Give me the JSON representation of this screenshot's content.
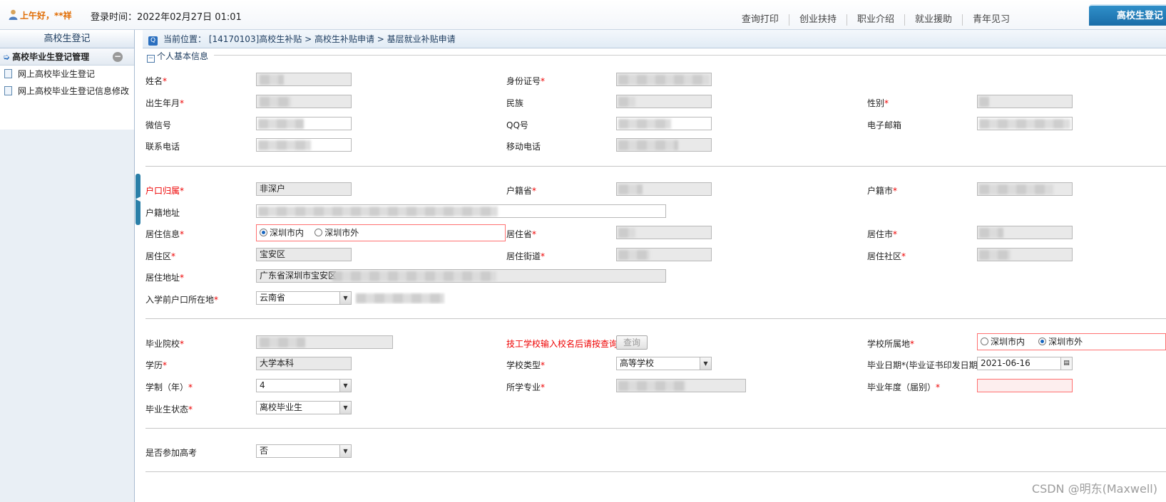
{
  "header": {
    "greeting": "上午好，**祥",
    "login_time": "登录时间：2022年02月27日 01:01",
    "nav": [
      "查询打印",
      "创业扶持",
      "职业介绍",
      "就业援助",
      "青年见习"
    ],
    "active_tab": "高校生登记"
  },
  "sidebar": {
    "title": "高校生登记",
    "group": "高校毕业生登记管理",
    "items": [
      "网上高校毕业生登记",
      "网上高校毕业生登记信息修改"
    ]
  },
  "breadcrumb": "当前位置：  [14170103]高校生补贴 > 高校生补贴申请 > 基层就业补贴申请",
  "section_title": "个人基本信息",
  "labels": {
    "name": "姓名",
    "id_no": "身份证号",
    "birth": "出生年月",
    "nation": "民族",
    "gender": "性别",
    "wechat": "微信号",
    "qq": "QQ号",
    "email": "电子邮箱",
    "phone": "联系电话",
    "mobile": "移动电话",
    "hukou_type": "户口归属",
    "hukou_prov": "户籍省",
    "hukou_city": "户籍市",
    "hukou_addr": "户籍地址",
    "res_info": "居住信息",
    "res_prov": "居住省",
    "res_city": "居住市",
    "res_district": "居住区",
    "res_street": "居住街道",
    "res_community": "居住社区",
    "res_addr": "居住地址",
    "pre_hukou": "入学前户口所在地",
    "school": "毕业院校",
    "tech_hint": "技工学校输入校名后请按查询",
    "school_loc": "学校所属地",
    "education": "学历",
    "school_type": "学校类型",
    "grad_date": "毕业日期*(毕业证书印发日期)",
    "years": "学制（年）",
    "major": "所学专业",
    "grad_year": "毕业年度（届别）",
    "grad_status": "毕业生状态",
    "gaokao": "是否参加高考"
  },
  "values": {
    "hukou_type": "非深户",
    "res_in": "深圳市内",
    "res_out": "深圳市外",
    "res_district": "宝安区",
    "res_addr": "广东省深圳市宝安区",
    "pre_hukou": "云南省",
    "query_btn": "查询",
    "school_in": "深圳市内",
    "school_out": "深圳市外",
    "education": "大学本科",
    "school_type": "高等学校",
    "grad_date": "2021-06-16",
    "years": "4",
    "grad_status": "离校毕业生",
    "gaokao": "否"
  },
  "watermark": "CSDN @明东(Maxwell)"
}
